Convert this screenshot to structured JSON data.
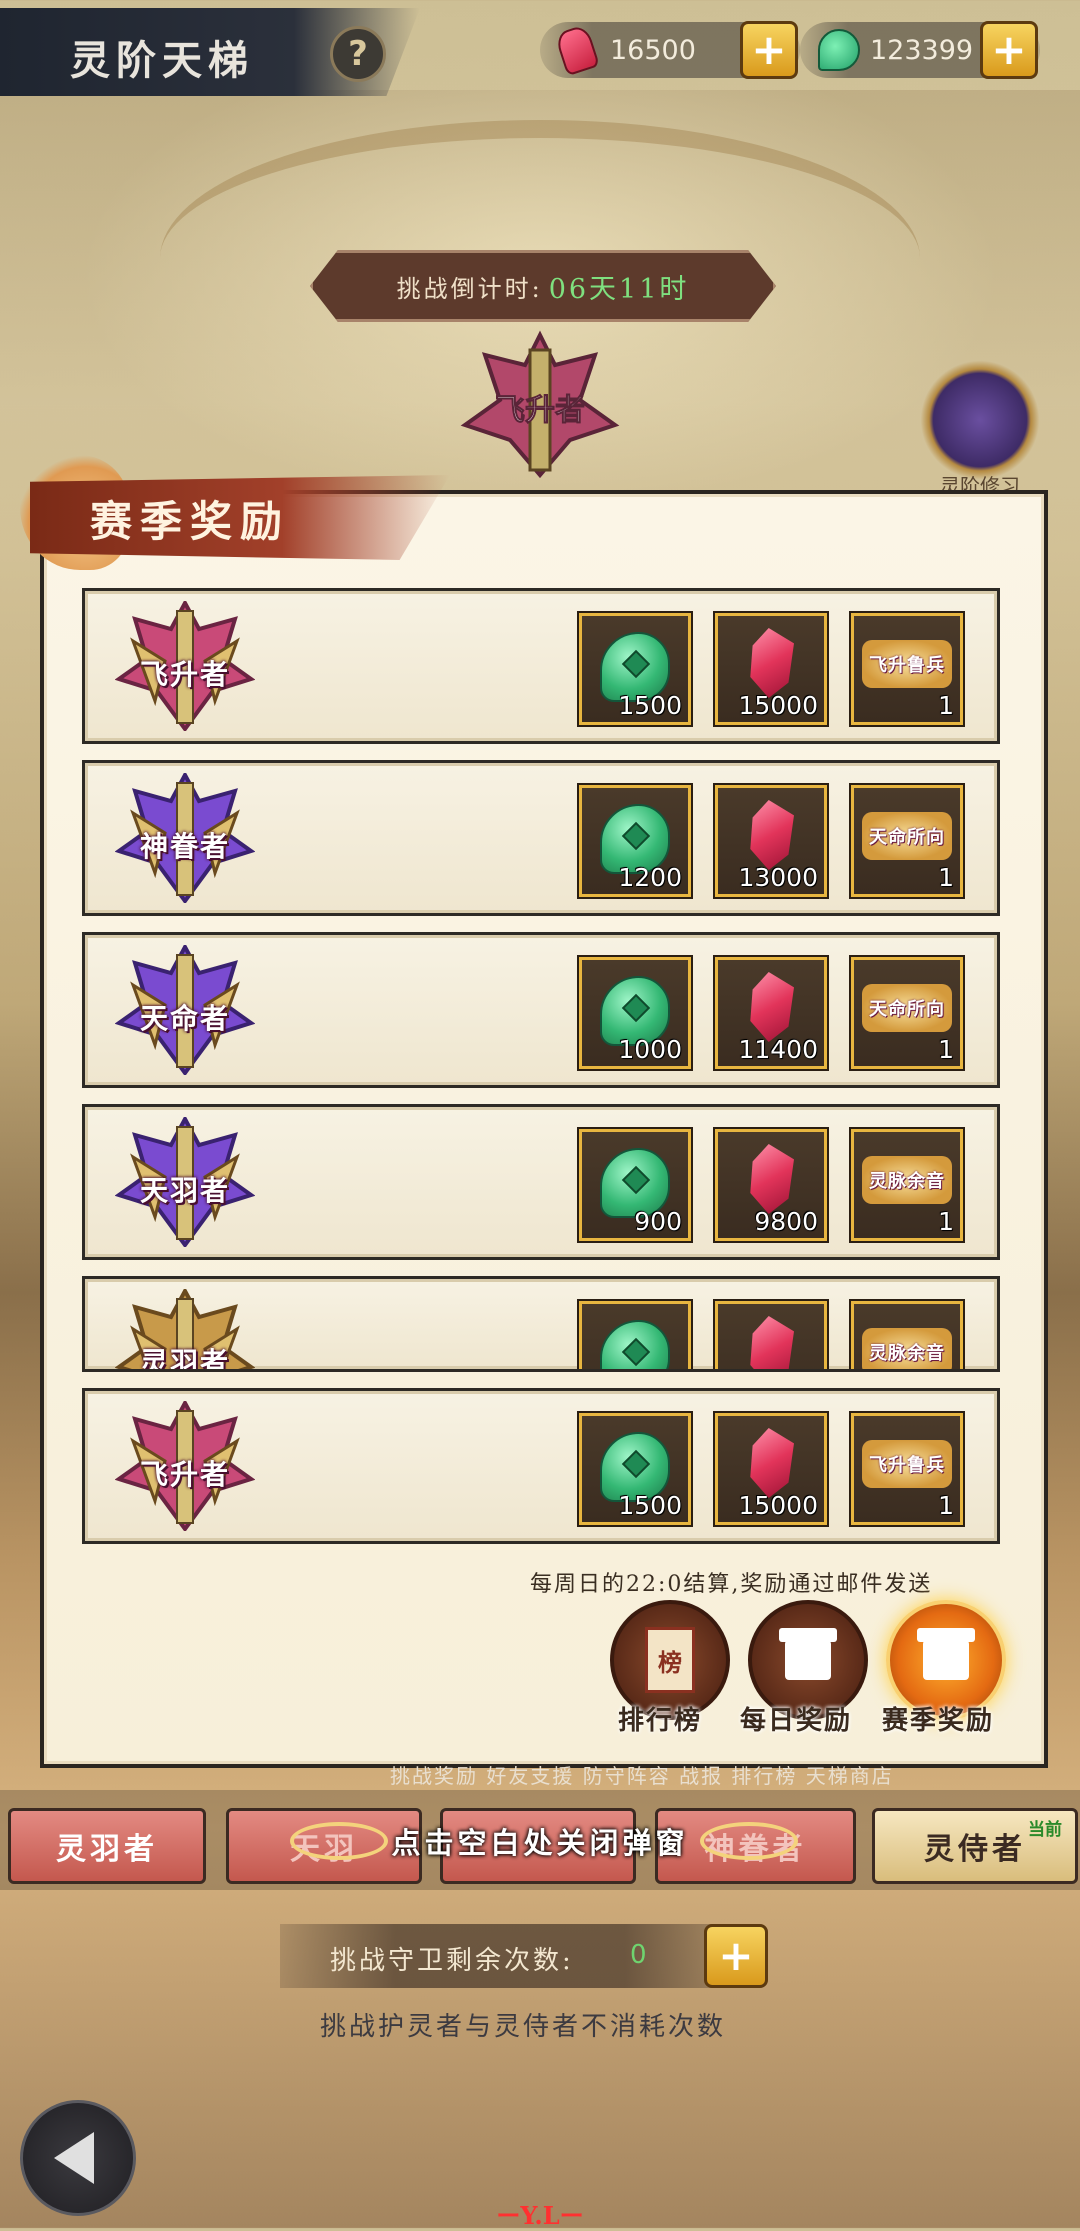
{
  "header": {
    "title": "灵阶天梯",
    "help_icon": "?",
    "currencies": [
      {
        "icon": "red-gem-icon",
        "value": "16500"
      },
      {
        "icon": "jade-icon",
        "value": "123399"
      }
    ],
    "plus_label": "+"
  },
  "countdown": {
    "label": "挑战倒计时:",
    "value": "06天11时"
  },
  "bg_emblem_label": "飞升者",
  "side_emblem_label": "灵阶修习",
  "modal": {
    "title": "赛季奖励",
    "rows": [
      {
        "rank": "飞升者",
        "rewards": [
          {
            "type": "jade",
            "count": "1500"
          },
          {
            "type": "gem",
            "count": "15000"
          },
          {
            "type": "token",
            "name": "飞升鲁兵",
            "count": "1"
          }
        ]
      },
      {
        "rank": "神眷者",
        "rewards": [
          {
            "type": "jade",
            "count": "1200"
          },
          {
            "type": "gem",
            "count": "13000"
          },
          {
            "type": "token",
            "name": "天命所向",
            "count": "1"
          }
        ]
      },
      {
        "rank": "天命者",
        "rewards": [
          {
            "type": "jade",
            "count": "1000"
          },
          {
            "type": "gem",
            "count": "11400"
          },
          {
            "type": "token",
            "name": "天命所向",
            "count": "1"
          }
        ]
      },
      {
        "rank": "天羽者",
        "rewards": [
          {
            "type": "jade",
            "count": "900"
          },
          {
            "type": "gem",
            "count": "9800"
          },
          {
            "type": "token",
            "name": "灵脉余音",
            "count": "1"
          }
        ]
      },
      {
        "rank": "灵羽者",
        "rewards": [
          {
            "type": "jade",
            "count": ""
          },
          {
            "type": "gem",
            "count": ""
          },
          {
            "type": "token",
            "name": "灵脉余音",
            "count": ""
          }
        ]
      },
      {
        "rank": "飞升者",
        "rewards": [
          {
            "type": "jade",
            "count": "1500"
          },
          {
            "type": "gem",
            "count": "15000"
          },
          {
            "type": "token",
            "name": "飞升鲁兵",
            "count": "1"
          }
        ]
      }
    ],
    "note": "每周日的22:0结算,奖励通过邮件发送",
    "buttons": [
      {
        "label": "排行榜",
        "glyph": "榜"
      },
      {
        "label": "每日奖励"
      },
      {
        "label": "赛季奖励"
      }
    ]
  },
  "bottom": {
    "menu_line": "挑战奖励  好友支援  防守阵容    战报      排行榜  天梯商店",
    "tabs": [
      "灵羽者",
      "天羽",
      "",
      "神眷者",
      "灵侍者"
    ],
    "current_badge": "当前",
    "toast": "点击空白处关闭弹窗",
    "remaining_label": "挑战守卫剩余次数:",
    "remaining_value": "0",
    "note": "挑战护灵者与灵侍者不消耗次数",
    "bottom_mark": "ーY.Lー"
  }
}
